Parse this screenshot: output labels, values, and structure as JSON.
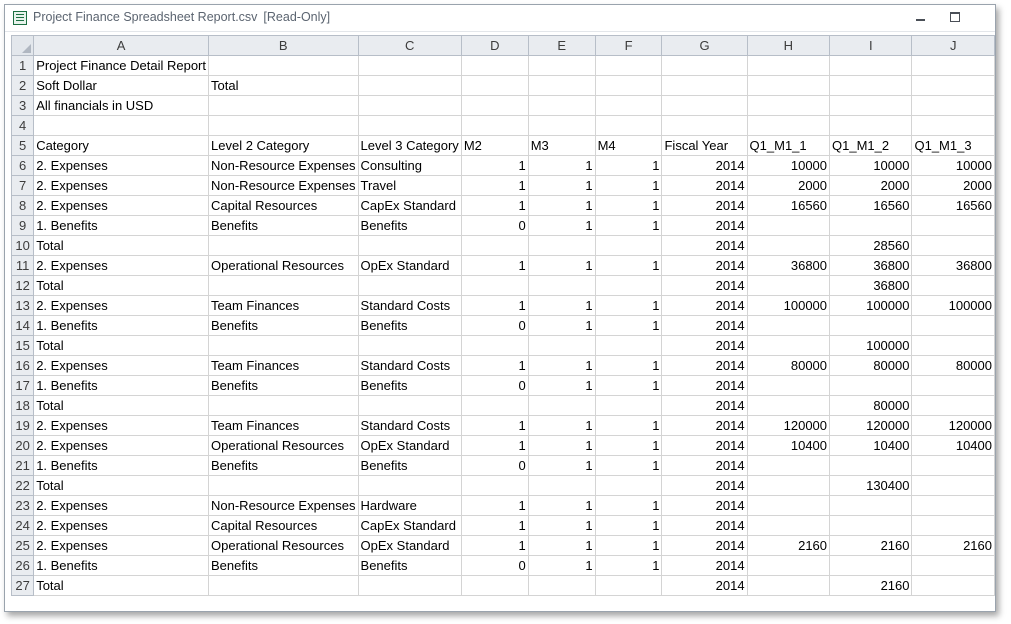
{
  "window": {
    "title": "Project Finance Spreadsheet Report.csv",
    "mode": "[Read-Only]"
  },
  "columns": [
    "A",
    "B",
    "C",
    "D",
    "E",
    "F",
    "G",
    "H",
    "I",
    "J"
  ],
  "rows": [
    {
      "n": "1",
      "cells": [
        "Project Finance Detail Report",
        "",
        "",
        "",
        "",
        "",
        "",
        "",
        "",
        ""
      ]
    },
    {
      "n": "2",
      "cells": [
        "Soft Dollar",
        "Total",
        "",
        "",
        "",
        "",
        "",
        "",
        "",
        ""
      ]
    },
    {
      "n": "3",
      "cells": [
        "All financials in USD",
        "",
        "",
        "",
        "",
        "",
        "",
        "",
        "",
        ""
      ]
    },
    {
      "n": "4",
      "cells": [
        "",
        "",
        "",
        "",
        "",
        "",
        "",
        "",
        "",
        ""
      ]
    },
    {
      "n": "5",
      "cells": [
        "Category",
        "Level 2 Category",
        "Level 3 Category",
        "M2",
        "M3",
        "M4",
        "Fiscal Year",
        "Q1_M1_1",
        "Q1_M1_2",
        "Q1_M1_3"
      ]
    },
    {
      "n": "6",
      "cells": [
        "2. Expenses",
        "Non-Resource Expenses",
        "Consulting",
        "1",
        "1",
        "1",
        "2014",
        "10000",
        "10000",
        "10000"
      ]
    },
    {
      "n": "7",
      "cells": [
        "2. Expenses",
        "Non-Resource Expenses",
        "Travel",
        "1",
        "1",
        "1",
        "2014",
        "2000",
        "2000",
        "2000"
      ]
    },
    {
      "n": "8",
      "cells": [
        "2. Expenses",
        "Capital Resources",
        "CapEx Standard",
        "1",
        "1",
        "1",
        "2014",
        "16560",
        "16560",
        "16560"
      ]
    },
    {
      "n": "9",
      "cells": [
        "1. Benefits",
        "Benefits",
        "Benefits",
        "0",
        "1",
        "1",
        "2014",
        "",
        "",
        ""
      ]
    },
    {
      "n": "10",
      "cells": [
        "Total",
        "",
        "",
        "",
        "",
        "",
        "2014",
        "",
        "28560",
        ""
      ]
    },
    {
      "n": "11",
      "cells": [
        "2. Expenses",
        "Operational Resources",
        "OpEx Standard",
        "1",
        "1",
        "1",
        "2014",
        "36800",
        "36800",
        "36800"
      ]
    },
    {
      "n": "12",
      "cells": [
        "Total",
        "",
        "",
        "",
        "",
        "",
        "2014",
        "",
        "36800",
        ""
      ]
    },
    {
      "n": "13",
      "cells": [
        "2. Expenses",
        "Team Finances",
        "Standard Costs",
        "1",
        "1",
        "1",
        "2014",
        "100000",
        "100000",
        "100000"
      ]
    },
    {
      "n": "14",
      "cells": [
        "1. Benefits",
        "Benefits",
        "Benefits",
        "0",
        "1",
        "1",
        "2014",
        "",
        "",
        ""
      ]
    },
    {
      "n": "15",
      "cells": [
        "Total",
        "",
        "",
        "",
        "",
        "",
        "2014",
        "",
        "100000",
        ""
      ]
    },
    {
      "n": "16",
      "cells": [
        "2. Expenses",
        "Team Finances",
        "Standard Costs",
        "1",
        "1",
        "1",
        "2014",
        "80000",
        "80000",
        "80000"
      ]
    },
    {
      "n": "17",
      "cells": [
        "1. Benefits",
        "Benefits",
        "Benefits",
        "0",
        "1",
        "1",
        "2014",
        "",
        "",
        ""
      ]
    },
    {
      "n": "18",
      "cells": [
        "Total",
        "",
        "",
        "",
        "",
        "",
        "2014",
        "",
        "80000",
        ""
      ]
    },
    {
      "n": "19",
      "cells": [
        "2. Expenses",
        "Team Finances",
        "Standard Costs",
        "1",
        "1",
        "1",
        "2014",
        "120000",
        "120000",
        "120000"
      ]
    },
    {
      "n": "20",
      "cells": [
        "2. Expenses",
        "Operational Resources",
        "OpEx Standard",
        "1",
        "1",
        "1",
        "2014",
        "10400",
        "10400",
        "10400"
      ]
    },
    {
      "n": "21",
      "cells": [
        "1. Benefits",
        "Benefits",
        "Benefits",
        "0",
        "1",
        "1",
        "2014",
        "",
        "",
        ""
      ]
    },
    {
      "n": "22",
      "cells": [
        "Total",
        "",
        "",
        "",
        "",
        "",
        "2014",
        "",
        "130400",
        ""
      ]
    },
    {
      "n": "23",
      "cells": [
        "2. Expenses",
        "Non-Resource Expenses",
        "Hardware",
        "1",
        "1",
        "1",
        "2014",
        "",
        "",
        ""
      ]
    },
    {
      "n": "24",
      "cells": [
        "2. Expenses",
        "Capital Resources",
        "CapEx Standard",
        "1",
        "1",
        "1",
        "2014",
        "",
        "",
        ""
      ]
    },
    {
      "n": "25",
      "cells": [
        "2. Expenses",
        "Operational Resources",
        "OpEx Standard",
        "1",
        "1",
        "1",
        "2014",
        "2160",
        "2160",
        "2160"
      ]
    },
    {
      "n": "26",
      "cells": [
        "1. Benefits",
        "Benefits",
        "Benefits",
        "0",
        "1",
        "1",
        "2014",
        "",
        "",
        ""
      ]
    },
    {
      "n": "27",
      "cells": [
        "Total",
        "",
        "",
        "",
        "",
        "",
        "2014",
        "",
        "2160",
        ""
      ]
    }
  ]
}
